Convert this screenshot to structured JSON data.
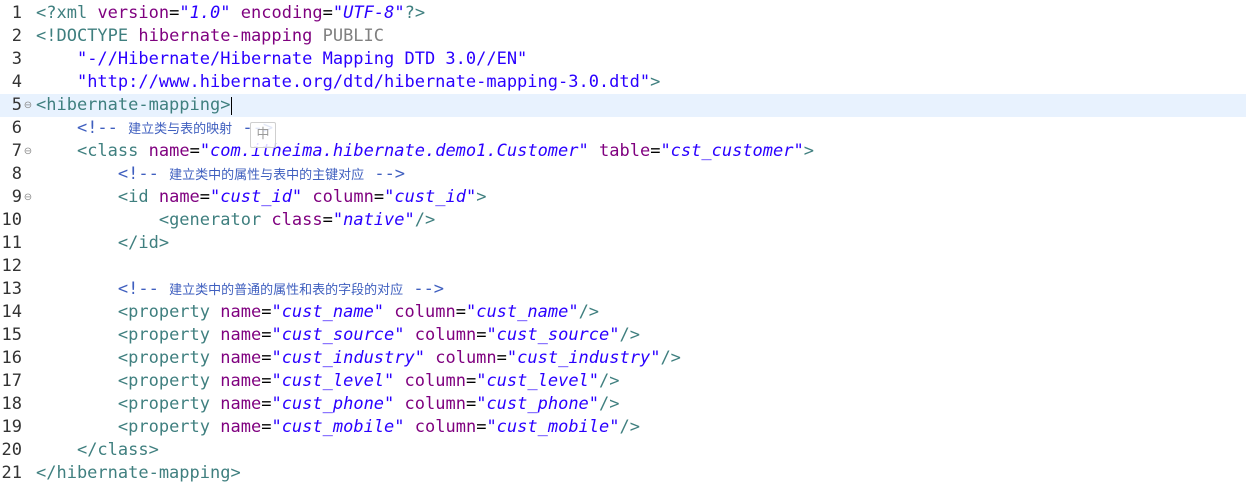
{
  "ime_indicator": "中",
  "lines": [
    {
      "n": "1",
      "fold": "",
      "tokens": [
        {
          "t": "<?",
          "c": "pi"
        },
        {
          "t": "xml ",
          "c": "pi"
        },
        {
          "t": "version",
          "c": "piattr"
        },
        {
          "t": "=",
          "c": "eq"
        },
        {
          "t": "\"1.0\"",
          "c": "val"
        },
        {
          "t": " ",
          "c": "eq"
        },
        {
          "t": "encoding",
          "c": "piattr"
        },
        {
          "t": "=",
          "c": "eq"
        },
        {
          "t": "\"UTF-8\"",
          "c": "val"
        },
        {
          "t": "?>",
          "c": "pi"
        }
      ]
    },
    {
      "n": "2",
      "fold": "",
      "tokens": [
        {
          "t": "<!DOCTYPE ",
          "c": "doctype"
        },
        {
          "t": "hibernate-mapping ",
          "c": "dtdname"
        },
        {
          "t": "PUBLIC",
          "c": "public"
        }
      ]
    },
    {
      "n": "3",
      "fold": "",
      "tokens": [
        {
          "t": "    ",
          "c": "eq"
        },
        {
          "t": "\"-//Hibernate/Hibernate Mapping DTD 3.0//EN\"",
          "c": "dtdstr"
        }
      ]
    },
    {
      "n": "4",
      "fold": "",
      "tokens": [
        {
          "t": "    ",
          "c": "eq"
        },
        {
          "t": "\"http://www.hibernate.org/dtd/hibernate-mapping-3.0.dtd\"",
          "c": "dtdstr"
        },
        {
          "t": ">",
          "c": "doctype"
        }
      ]
    },
    {
      "n": "5",
      "fold": "⊖",
      "current": true,
      "tokens": [
        {
          "t": "<hibernate-mapping>",
          "c": "tag"
        }
      ]
    },
    {
      "n": "6",
      "fold": "",
      "tokens": [
        {
          "t": "    ",
          "c": "eq"
        },
        {
          "t": "<!-- ",
          "c": "comment"
        },
        {
          "t": "建立类与表的映射",
          "c": "comment cjk"
        },
        {
          "t": " -->",
          "c": "comment"
        }
      ]
    },
    {
      "n": "7",
      "fold": "⊖",
      "tokens": [
        {
          "t": "    ",
          "c": "eq"
        },
        {
          "t": "<class ",
          "c": "tag"
        },
        {
          "t": "name",
          "c": "attr"
        },
        {
          "t": "=",
          "c": "eq"
        },
        {
          "t": "\"com.itheima.hibernate.demo1.Customer\"",
          "c": "val"
        },
        {
          "t": " ",
          "c": "eq"
        },
        {
          "t": "table",
          "c": "attr"
        },
        {
          "t": "=",
          "c": "eq"
        },
        {
          "t": "\"cst_customer\"",
          "c": "val"
        },
        {
          "t": ">",
          "c": "tag"
        }
      ]
    },
    {
      "n": "8",
      "fold": "",
      "tokens": [
        {
          "t": "        ",
          "c": "eq"
        },
        {
          "t": "<!-- ",
          "c": "comment"
        },
        {
          "t": "建立类中的属性与表中的主键对应",
          "c": "comment cjk"
        },
        {
          "t": " -->",
          "c": "comment"
        }
      ]
    },
    {
      "n": "9",
      "fold": "⊖",
      "tokens": [
        {
          "t": "        ",
          "c": "eq"
        },
        {
          "t": "<id ",
          "c": "tag"
        },
        {
          "t": "name",
          "c": "attr"
        },
        {
          "t": "=",
          "c": "eq"
        },
        {
          "t": "\"cust_id\"",
          "c": "val"
        },
        {
          "t": " ",
          "c": "eq"
        },
        {
          "t": "column",
          "c": "attr"
        },
        {
          "t": "=",
          "c": "eq"
        },
        {
          "t": "\"cust_id\"",
          "c": "val"
        },
        {
          "t": ">",
          "c": "tag"
        }
      ]
    },
    {
      "n": "10",
      "fold": "",
      "tokens": [
        {
          "t": "            ",
          "c": "eq"
        },
        {
          "t": "<generator ",
          "c": "tag"
        },
        {
          "t": "class",
          "c": "attr"
        },
        {
          "t": "=",
          "c": "eq"
        },
        {
          "t": "\"native\"",
          "c": "val"
        },
        {
          "t": "/>",
          "c": "tag"
        }
      ]
    },
    {
      "n": "11",
      "fold": "",
      "tokens": [
        {
          "t": "        ",
          "c": "eq"
        },
        {
          "t": "</id>",
          "c": "tag"
        }
      ]
    },
    {
      "n": "12",
      "fold": "",
      "tokens": []
    },
    {
      "n": "13",
      "fold": "",
      "tokens": [
        {
          "t": "        ",
          "c": "eq"
        },
        {
          "t": "<!-- ",
          "c": "comment"
        },
        {
          "t": "建立类中的普通的属性和表的字段的对应",
          "c": "comment cjk"
        },
        {
          "t": " -->",
          "c": "comment"
        }
      ]
    },
    {
      "n": "14",
      "fold": "",
      "tokens": [
        {
          "t": "        ",
          "c": "eq"
        },
        {
          "t": "<property ",
          "c": "tag"
        },
        {
          "t": "name",
          "c": "attr"
        },
        {
          "t": "=",
          "c": "eq"
        },
        {
          "t": "\"cust_name\"",
          "c": "val"
        },
        {
          "t": " ",
          "c": "eq"
        },
        {
          "t": "column",
          "c": "attr"
        },
        {
          "t": "=",
          "c": "eq"
        },
        {
          "t": "\"cust_name\"",
          "c": "val"
        },
        {
          "t": "/>",
          "c": "tag"
        }
      ]
    },
    {
      "n": "15",
      "fold": "",
      "tokens": [
        {
          "t": "        ",
          "c": "eq"
        },
        {
          "t": "<property ",
          "c": "tag"
        },
        {
          "t": "name",
          "c": "attr"
        },
        {
          "t": "=",
          "c": "eq"
        },
        {
          "t": "\"cust_source\"",
          "c": "val"
        },
        {
          "t": " ",
          "c": "eq"
        },
        {
          "t": "column",
          "c": "attr"
        },
        {
          "t": "=",
          "c": "eq"
        },
        {
          "t": "\"cust_source\"",
          "c": "val"
        },
        {
          "t": "/>",
          "c": "tag"
        }
      ]
    },
    {
      "n": "16",
      "fold": "",
      "tokens": [
        {
          "t": "        ",
          "c": "eq"
        },
        {
          "t": "<property ",
          "c": "tag"
        },
        {
          "t": "name",
          "c": "attr"
        },
        {
          "t": "=",
          "c": "eq"
        },
        {
          "t": "\"cust_industry\"",
          "c": "val"
        },
        {
          "t": " ",
          "c": "eq"
        },
        {
          "t": "column",
          "c": "attr"
        },
        {
          "t": "=",
          "c": "eq"
        },
        {
          "t": "\"cust_industry\"",
          "c": "val"
        },
        {
          "t": "/>",
          "c": "tag"
        }
      ]
    },
    {
      "n": "17",
      "fold": "",
      "tokens": [
        {
          "t": "        ",
          "c": "eq"
        },
        {
          "t": "<property ",
          "c": "tag"
        },
        {
          "t": "name",
          "c": "attr"
        },
        {
          "t": "=",
          "c": "eq"
        },
        {
          "t": "\"cust_level\"",
          "c": "val"
        },
        {
          "t": " ",
          "c": "eq"
        },
        {
          "t": "column",
          "c": "attr"
        },
        {
          "t": "=",
          "c": "eq"
        },
        {
          "t": "\"cust_level\"",
          "c": "val"
        },
        {
          "t": "/>",
          "c": "tag"
        }
      ]
    },
    {
      "n": "18",
      "fold": "",
      "tokens": [
        {
          "t": "        ",
          "c": "eq"
        },
        {
          "t": "<property ",
          "c": "tag"
        },
        {
          "t": "name",
          "c": "attr"
        },
        {
          "t": "=",
          "c": "eq"
        },
        {
          "t": "\"cust_phone\"",
          "c": "val"
        },
        {
          "t": " ",
          "c": "eq"
        },
        {
          "t": "column",
          "c": "attr"
        },
        {
          "t": "=",
          "c": "eq"
        },
        {
          "t": "\"cust_phone\"",
          "c": "val"
        },
        {
          "t": "/>",
          "c": "tag"
        }
      ]
    },
    {
      "n": "19",
      "fold": "",
      "tokens": [
        {
          "t": "        ",
          "c": "eq"
        },
        {
          "t": "<property ",
          "c": "tag"
        },
        {
          "t": "name",
          "c": "attr"
        },
        {
          "t": "=",
          "c": "eq"
        },
        {
          "t": "\"cust_mobile\"",
          "c": "val"
        },
        {
          "t": " ",
          "c": "eq"
        },
        {
          "t": "column",
          "c": "attr"
        },
        {
          "t": "=",
          "c": "eq"
        },
        {
          "t": "\"cust_mobile\"",
          "c": "val"
        },
        {
          "t": "/>",
          "c": "tag"
        }
      ]
    },
    {
      "n": "20",
      "fold": "",
      "tokens": [
        {
          "t": "    ",
          "c": "eq"
        },
        {
          "t": "</class>",
          "c": "tag"
        }
      ]
    },
    {
      "n": "21",
      "fold": "",
      "tokens": [
        {
          "t": "</hibernate-mapping>",
          "c": "tag"
        }
      ]
    }
  ]
}
